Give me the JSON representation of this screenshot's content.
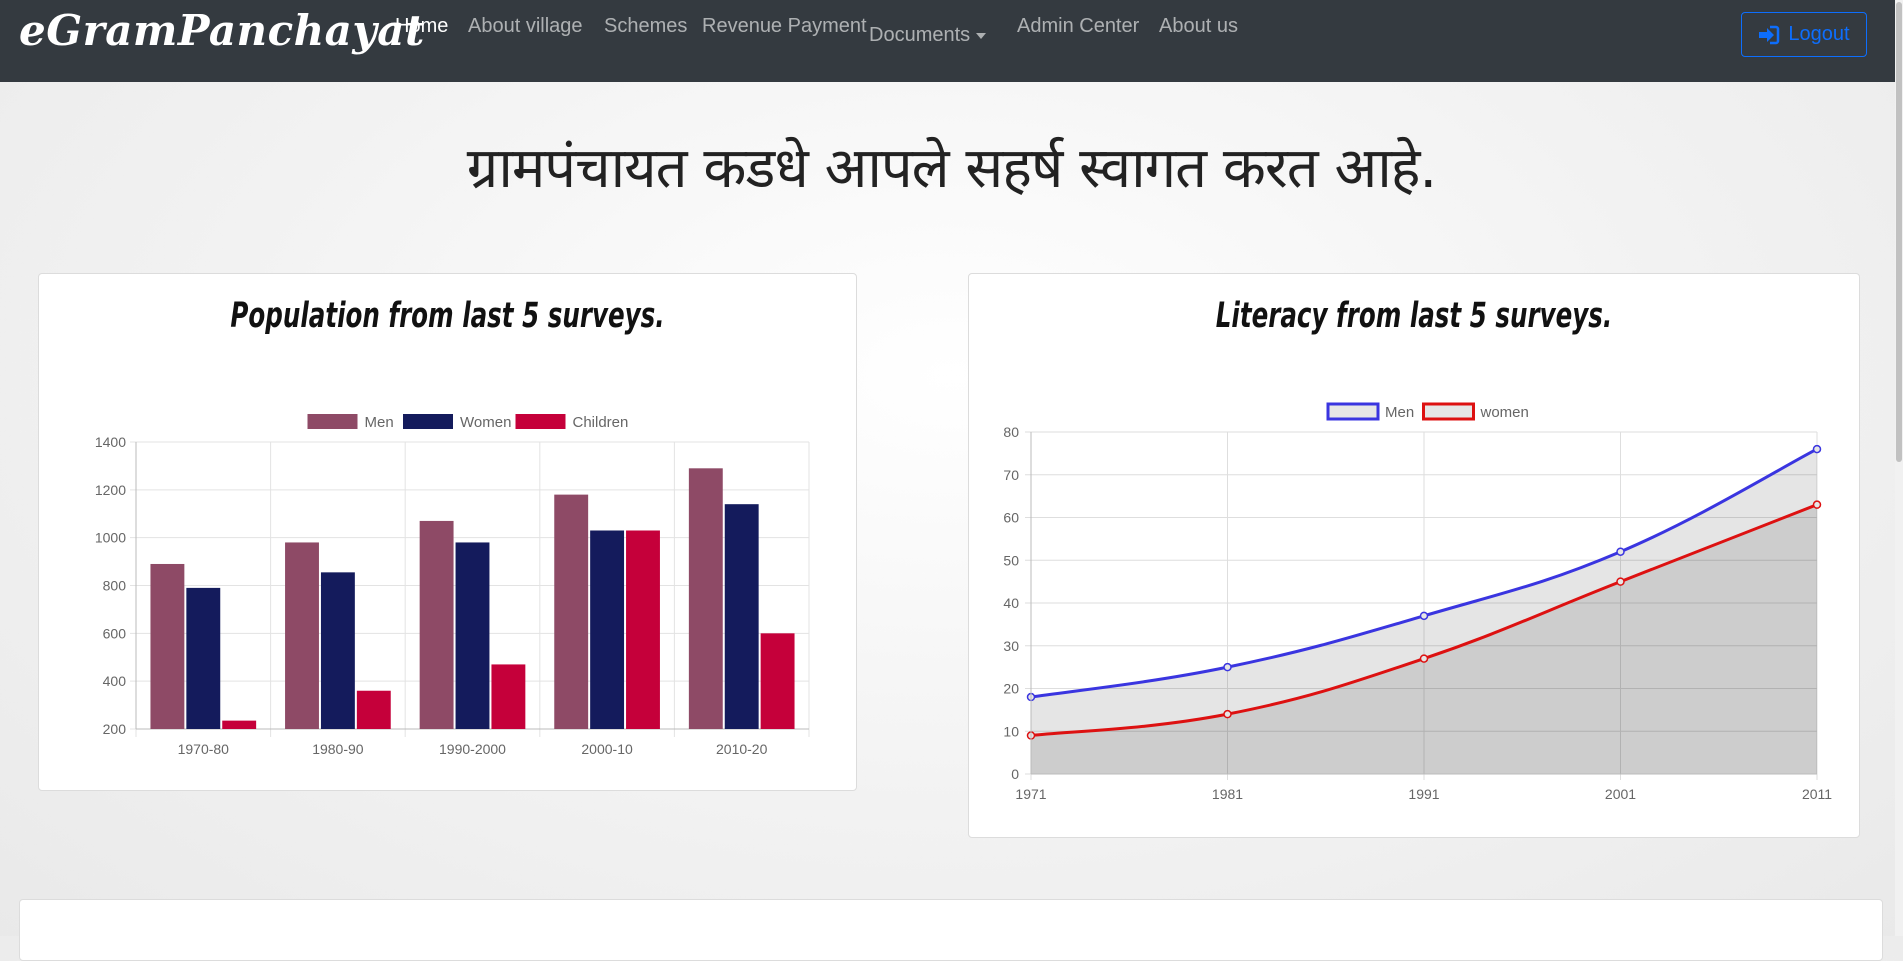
{
  "navbar": {
    "brand": "eGramPanchayat",
    "links": [
      {
        "label": "Home",
        "active": true
      },
      {
        "label": "About village"
      },
      {
        "label": "Schemes"
      },
      {
        "label": "Revenue Payment"
      },
      {
        "label": "Documents",
        "dropdown": true
      },
      {
        "label": "Admin Center"
      },
      {
        "label": "About us"
      }
    ],
    "logout_label": "Logout",
    "logout_icon": "sign-in-icon"
  },
  "welcome_text": "ग्रामपंचायत कडधे आपले सहर्ष स्वागत करत आहे.",
  "population_card": {
    "title": "Population from last 5 surveys."
  },
  "literacy_card": {
    "title": "Literacy from last 5 surveys."
  },
  "chart_data": [
    {
      "type": "bar",
      "categories": [
        "1970-80",
        "1980-90",
        "1990-2000",
        "2000-10",
        "2010-20"
      ],
      "series": [
        {
          "name": "Men",
          "values": [
            890,
            980,
            1070,
            1180,
            1290
          ],
          "color": "#8e4a66"
        },
        {
          "name": "Women",
          "values": [
            790,
            855,
            980,
            1030,
            1140
          ],
          "color": "#141b5c"
        },
        {
          "name": "Children",
          "values": [
            235,
            360,
            470,
            1030,
            600
          ],
          "color": "#c5003a"
        }
      ],
      "ylim": [
        200,
        1400
      ],
      "yticks": [
        200,
        400,
        600,
        800,
        1000,
        1200,
        1400
      ],
      "grid": true,
      "legend": "top"
    },
    {
      "type": "area",
      "x": [
        "1971",
        "1981",
        "1991",
        "2001",
        "2011"
      ],
      "series": [
        {
          "name": "Men",
          "values": [
            18,
            25,
            37,
            52,
            76
          ],
          "color": "#3a35e0"
        },
        {
          "name": "women",
          "values": [
            9,
            14,
            27,
            45,
            63
          ],
          "color": "#dd1111"
        }
      ],
      "ylim": [
        0,
        80
      ],
      "yticks": [
        0,
        10,
        20,
        30,
        40,
        50,
        60,
        70,
        80
      ],
      "grid": true,
      "legend": "top"
    }
  ]
}
